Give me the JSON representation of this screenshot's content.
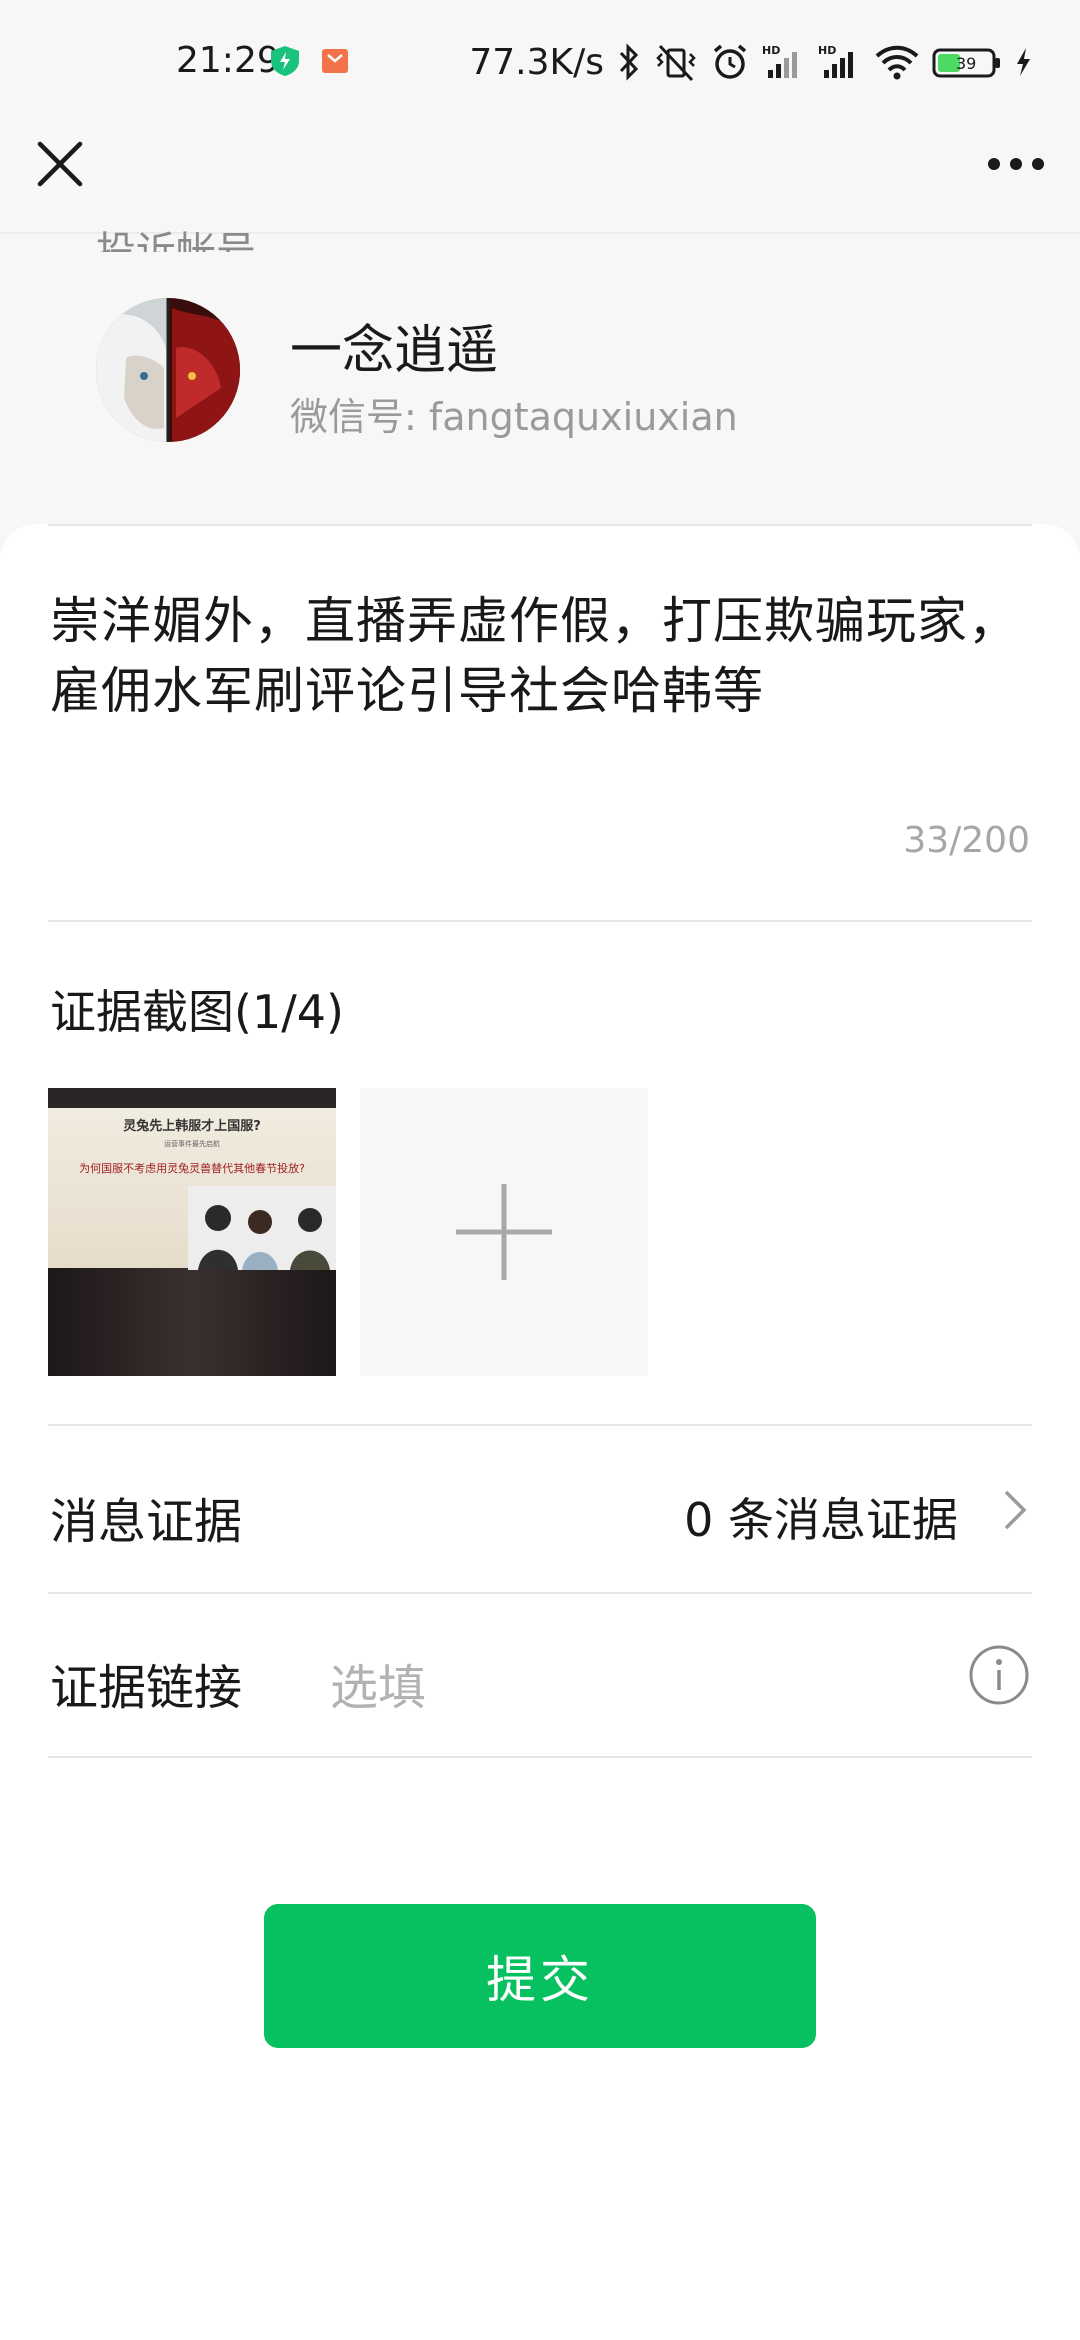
{
  "status_bar": {
    "time": "21:29",
    "network_speed": "77.3K/s",
    "battery": "39",
    "icons": [
      "shield-icon",
      "app-notification-icon",
      "bluetooth-icon",
      "vibrate-off-icon",
      "alarm-icon",
      "signal-hd-icon",
      "signal-hd-icon",
      "wifi-icon",
      "battery-icon",
      "charging-icon"
    ]
  },
  "nav": {
    "close_icon": "close-icon",
    "more_icon": "more-icon"
  },
  "account": {
    "section_label": "投诉帐号",
    "name": "一念逍遥",
    "wechat_id": "微信号: fangtaquxiuxian"
  },
  "report": {
    "description": "崇洋媚外，直播弄虚作假，打压欺骗玩家，雇佣水军刷评论引导社会哈韩等",
    "char_count": "33/200"
  },
  "evidence": {
    "title": "证据截图(1/4)",
    "thumbnail_headline": "灵兔先上韩服才上国服?",
    "thumbnail_subline": "运营事件最先启航",
    "thumbnail_question": "为何国服不考虑用灵兔灵兽替代其他春节投放?"
  },
  "message_evidence": {
    "label": "消息证据",
    "value": "0 条消息证据"
  },
  "evidence_link": {
    "label": "证据链接",
    "placeholder": "选填"
  },
  "submit_label": "提交",
  "colors": {
    "accent": "#07c160",
    "background": "#f7f7f7",
    "card": "#ffffff"
  }
}
